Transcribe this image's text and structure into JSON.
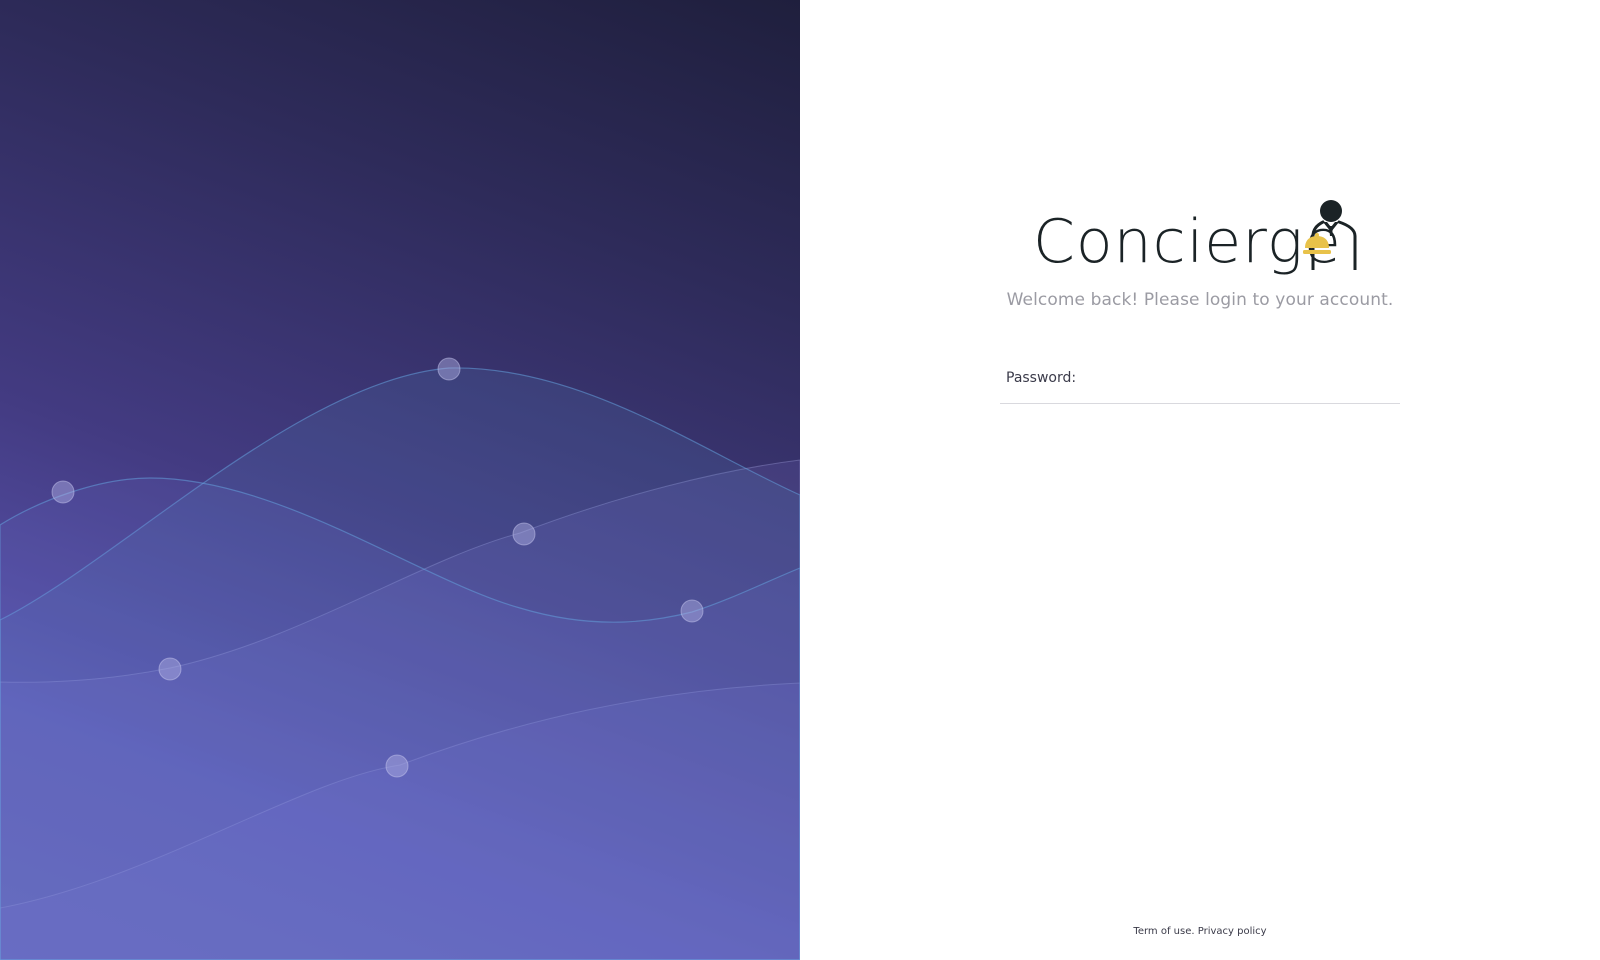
{
  "brand": {
    "name": "Concierge",
    "icon": "concierge-butler-bell-icon",
    "colors": {
      "text": "#1b2326",
      "bell": "#e8c24a"
    }
  },
  "login": {
    "welcome": "Welcome back! Please login to your account.",
    "password_label": "Password:",
    "password_value": "",
    "password_placeholder": ""
  },
  "footer": {
    "terms_label": "Term of use.",
    "privacy_label": "Privacy policy"
  },
  "hero": {
    "gradient": [
      "#1f1f3d",
      "#433b82",
      "#6260b5"
    ],
    "wave_color": "#7fa6d6"
  }
}
